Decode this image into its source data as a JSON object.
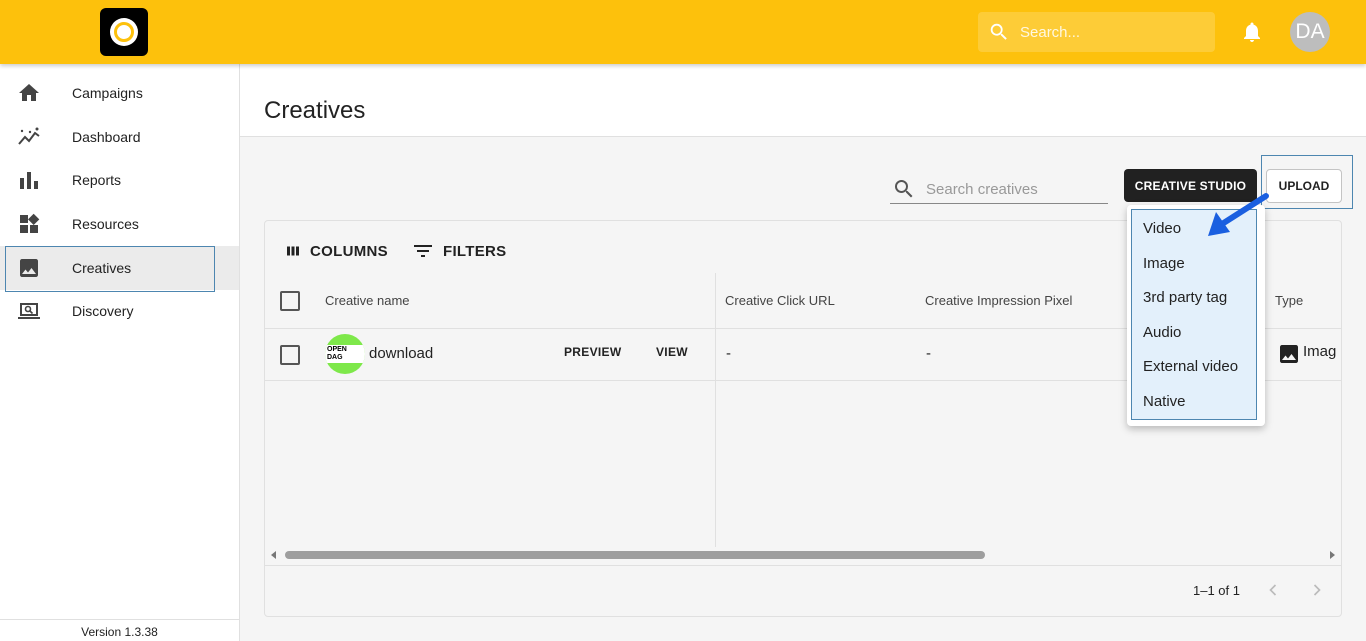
{
  "header": {
    "search_placeholder": "Search...",
    "avatar_initials": "DA"
  },
  "sidebar": {
    "items": [
      {
        "label": "Campaigns",
        "icon": "home-icon"
      },
      {
        "label": "Dashboard",
        "icon": "trend-icon"
      },
      {
        "label": "Reports",
        "icon": "bar-chart-icon"
      },
      {
        "label": "Resources",
        "icon": "widgets-icon"
      },
      {
        "label": "Creatives",
        "icon": "image-icon",
        "active": true
      },
      {
        "label": "Discovery",
        "icon": "laptop-search-icon"
      }
    ],
    "version": "Version 1.3.38"
  },
  "main": {
    "title": "Creatives",
    "search_placeholder": "Search creatives",
    "creative_studio_label": "CREATIVE STUDIO",
    "upload_label": "UPLOAD"
  },
  "grid": {
    "toolbar": {
      "columns_label": "COLUMNS",
      "filters_label": "FILTERS"
    },
    "columns": [
      "Creative name",
      "Creative Click URL",
      "Creative Impression Pixel",
      "Type"
    ],
    "rows": [
      {
        "name": "download",
        "thumb_text": "OPEN DAG",
        "preview_label": "PREVIEW",
        "view_label": "VIEW",
        "click_url": "-",
        "impression_pixel": "-",
        "type": "Imag"
      }
    ],
    "pagination": "1–1 of 1"
  },
  "upload_menu": {
    "items": [
      "Video",
      "Image",
      "3rd party tag",
      "Audio",
      "External video",
      "Native"
    ]
  },
  "colors": {
    "topbar": "#fdc10c",
    "focus_outline": "#4d86b0",
    "annotation_arrow": "#1a5fe0"
  }
}
